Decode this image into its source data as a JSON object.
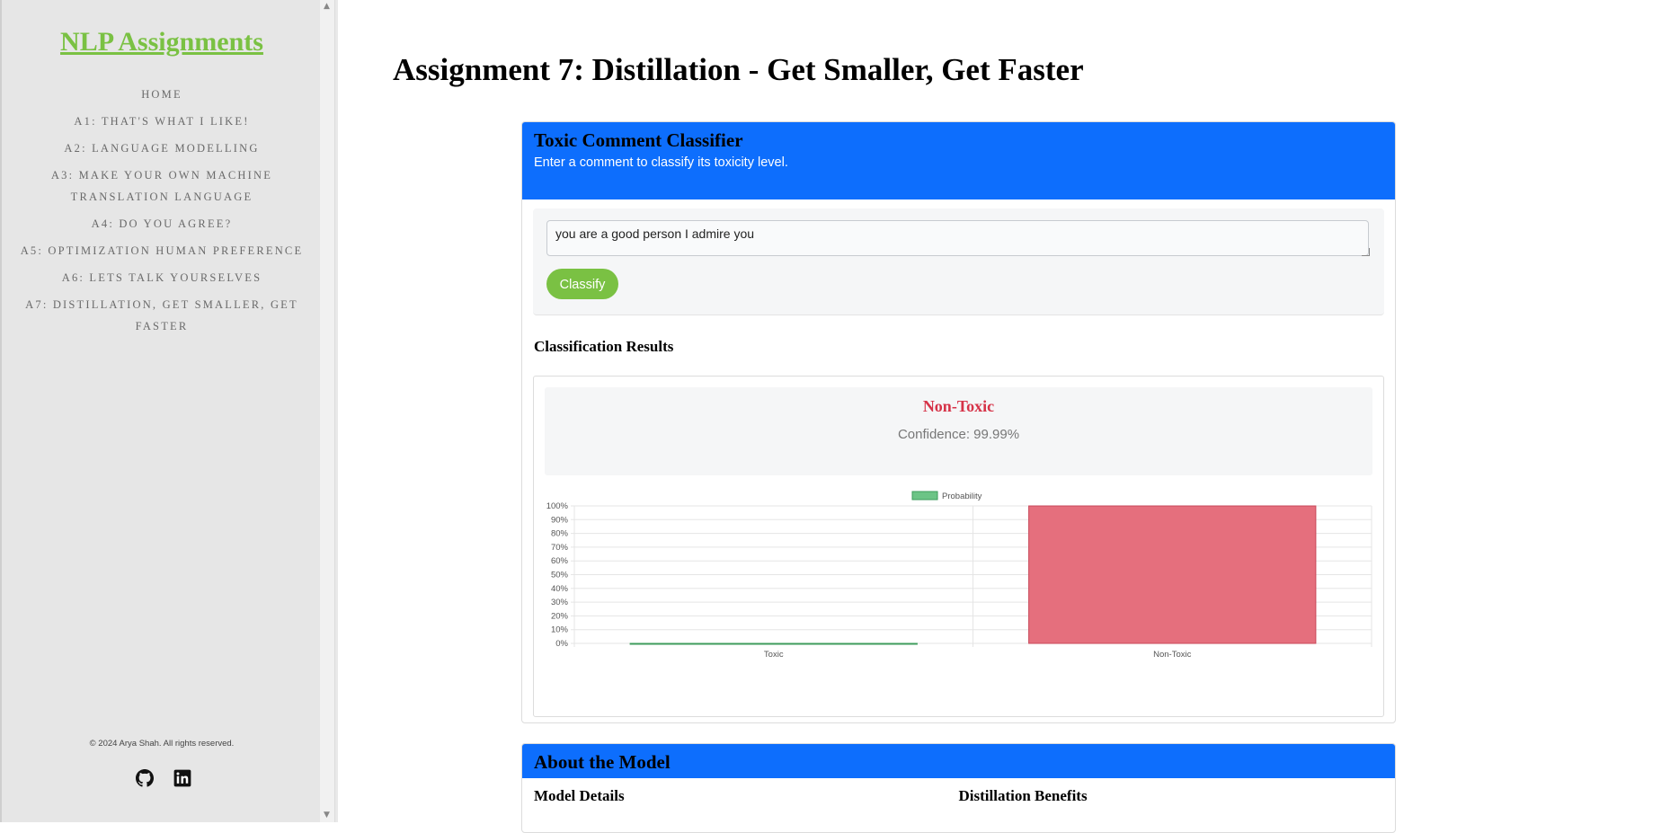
{
  "sidebar": {
    "title": "NLP Assignments",
    "items": [
      {
        "label": "Home"
      },
      {
        "label": "A1: That's What I LIKE!"
      },
      {
        "label": "A2: Language Modelling"
      },
      {
        "label": "A3: Make Your Own Machine Translation Language"
      },
      {
        "label": "A4: Do You AGREE?"
      },
      {
        "label": "A5: Optimization Human Preference"
      },
      {
        "label": "A6: Lets Talk Yourselves"
      },
      {
        "label": "A7: Distillation, Get Smaller, Get Faster"
      }
    ],
    "footer": "© 2024 Arya Shah. All rights reserved.",
    "social": [
      {
        "icon": "github-icon"
      },
      {
        "icon": "linkedin-icon"
      }
    ]
  },
  "main": {
    "page_title": "Assignment 7: Distillation - Get Smaller, Get Faster",
    "classifier": {
      "title": "Toxic Comment Classifier",
      "subtitle": "Enter a comment to classify its toxicity level.",
      "input_value": "you are a good person I admire you",
      "button_label": "Classify",
      "results_heading": "Classification Results",
      "prediction": "Non-Toxic",
      "confidence": "Confidence: 99.99%"
    },
    "about": {
      "title": "About the Model",
      "col1": "Model Details",
      "col2": "Distillation Benefits"
    }
  },
  "colors": {
    "accent": "#7ac143",
    "header_blue": "#0d6efd",
    "toxic_bar": "#6cc486",
    "nontoxic_bar": "#e56f7d",
    "prediction_text": "#d63348"
  },
  "chart_data": {
    "type": "bar",
    "categories": [
      "Toxic",
      "Non-Toxic"
    ],
    "series": [
      {
        "name": "Probability",
        "values": [
          0.01,
          99.99
        ]
      }
    ],
    "ylim": [
      0,
      100
    ],
    "yticks": [
      "0%",
      "10%",
      "20%",
      "30%",
      "40%",
      "50%",
      "60%",
      "70%",
      "80%",
      "90%",
      "100%"
    ],
    "grid": true,
    "legend": "top-center"
  }
}
